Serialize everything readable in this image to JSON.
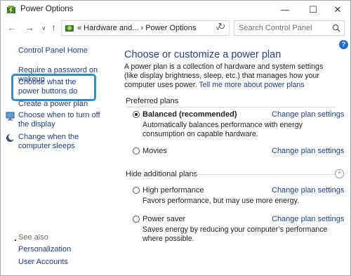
{
  "window": {
    "title": "Power Options",
    "minimize": "—",
    "maximize": "☐",
    "close": "✕"
  },
  "navbar": {
    "back": "←",
    "forward": "→",
    "recent": "∨",
    "up": "↑",
    "breadcrumb": "« Hardware and... › Power Options",
    "address_dropdown": "∨",
    "refresh": "↻",
    "search_placeholder": "Search Control Panel"
  },
  "sidebar": {
    "home": "Control Panel Home",
    "links": [
      "Require a password on wakeup",
      "Choose what the power buttons do",
      "Create a power plan",
      "Choose when to turn off the display",
      "Change when the computer sleeps"
    ],
    "see_also": "See also",
    "see_also_links": [
      "Personalization",
      "User Accounts"
    ]
  },
  "main": {
    "help": "?",
    "title": "Choose or customize a power plan",
    "description": "A power plan is a collection of hardware and system settings (like display brightness, sleep, etc.) that manages how your computer uses power. ",
    "learn_more": "Tell me more about power plans",
    "preferred_label": "Preferred plans",
    "hidden_label": "Hide additional plans",
    "collapse_icon": "^",
    "plans": [
      {
        "name": "Balanced (recommended)",
        "desc": "Automatically balances performance with energy consumption on capable hardware.",
        "selected": true,
        "change": "Change plan settings"
      },
      {
        "name": "Movies",
        "desc": "",
        "selected": false,
        "change": "Change plan settings"
      },
      {
        "name": "High performance",
        "desc": "Favors performance, but may use more energy.",
        "selected": false,
        "change": "Change plan settings"
      },
      {
        "name": "Power saver",
        "desc": "Saves energy by reducing your computer’s performance where possible.",
        "selected": false,
        "change": "Change plan settings"
      }
    ]
  },
  "colors": {
    "link": "#1a3d8f",
    "title": "#1f3f8f",
    "highlight": "#2e8fc9"
  }
}
